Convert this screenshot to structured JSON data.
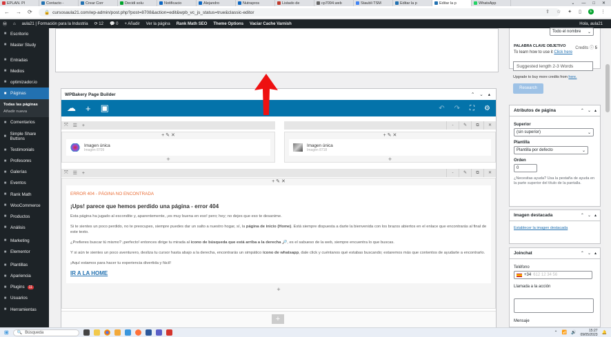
{
  "tabs": [
    {
      "label": "EPLAN. Pl",
      "color": "#d63638"
    },
    {
      "label": "Contacto -",
      "color": "#2271b1"
    },
    {
      "label": "Crear Corr",
      "color": "#2271b1"
    },
    {
      "label": "Decidi solu",
      "color": "#00a32a"
    },
    {
      "label": "Notificacio",
      "color": "#0a66c2"
    },
    {
      "label": "Alejandro",
      "color": "#0a66c2"
    },
    {
      "label": "Nutrapros",
      "color": "#0a66c2"
    },
    {
      "label": "Listado de",
      "color": "#c0392b"
    },
    {
      "label": "cp7094.web",
      "color": "#666"
    },
    {
      "label": "Staubli TSM",
      "color": "#4285f4"
    },
    {
      "label": "Editar la p",
      "color": "#2271b1"
    },
    {
      "label": "Editar la p",
      "color": "#2271b1"
    },
    {
      "label": "WhatsApp",
      "color": "#25d366"
    }
  ],
  "browser": {
    "url": "cursosaula21.com/wp-admin/post.php?post=8708&action=edit&wpb_vc_js_status=true&classic-editor",
    "tab_controls": [
      "⌄",
      "—",
      "□",
      "✕"
    ]
  },
  "adminbar": {
    "site": "aula21 | Formación para la Industria",
    "updates": "12",
    "comments": "0",
    "new": "+ Añadir",
    "view": "Ver la página",
    "seo": "Rank Math SEO",
    "theme": "Theme Options",
    "cache": "Vaciar Cache Varnish",
    "howdy": "Hola, aula21"
  },
  "sidebar": {
    "items": [
      {
        "label": "Escritorio",
        "icon": "dashboard-icon"
      },
      {
        "label": "Master Study",
        "icon": "m-icon"
      },
      {
        "label": "Entradas",
        "icon": "pin-icon"
      },
      {
        "label": "Medios",
        "icon": "media-icon"
      },
      {
        "label": "optimizador.io",
        "icon": "gear-icon"
      },
      {
        "label": "Páginas",
        "icon": "page-icon"
      }
    ],
    "sub": [
      "Todas las páginas",
      "Añadir nueva"
    ],
    "items2": [
      {
        "label": "Comentarios",
        "icon": "comment-icon"
      },
      {
        "label": "Simple Share Buttons",
        "icon": "share-icon"
      },
      {
        "label": "Testimonials",
        "icon": "quote-icon"
      },
      {
        "label": "Profesores",
        "icon": "user-icon"
      },
      {
        "label": "Galerías",
        "icon": "gallery-icon"
      },
      {
        "label": "Eventos",
        "icon": "calendar-icon"
      },
      {
        "label": "Rank Math",
        "icon": "chart-icon"
      },
      {
        "label": "WooCommerce",
        "icon": "woo-icon"
      },
      {
        "label": "Productos",
        "icon": "box-icon"
      },
      {
        "label": "Análisis",
        "icon": "bar-icon"
      },
      {
        "label": "Marketing",
        "icon": "megaphone-icon"
      },
      {
        "label": "Elementor",
        "icon": "e-icon"
      },
      {
        "label": "Plantillas",
        "icon": "folder-icon"
      },
      {
        "label": "Apariencia",
        "icon": "brush-icon"
      },
      {
        "label": "Plugins",
        "icon": "plug-icon",
        "badge": "11"
      },
      {
        "label": "Usuarios",
        "icon": "users-icon"
      },
      {
        "label": "Herramientas",
        "icon": "wrench-icon"
      }
    ]
  },
  "wpbakery": {
    "title": "WPBakery Page Builder",
    "el1": {
      "title": "Imagen única",
      "sub": "Imagen 8709"
    },
    "el2": {
      "title": "Imagen única",
      "sub": "Imagen 8718"
    },
    "error_heading": "ERROR 404 - PÁGINA NO ENCONTRADA",
    "h3": "¡Ups! parece que hemos perdido una página - error 404",
    "p1": "Esta página ha jugado al escondite y, aparentemente, ¡es muy buena en eso! pero; hey; no dejes que eso te desanime.",
    "p2a": "Si te sientes un poco perdido, no te preocupes, siempre puedes dar un salto a nuestro hogar, sí, la ",
    "p2b": "página de inicio (Home)",
    "p2c": ". Está siempre dispuesta a darte la bienvenida con los brazos abiertos en el enlace que encontrarás al final de este texto.",
    "p3a": "¿Prefieres buscar tú mismo? ¡perfecto! entonces dirige tu mirada al ",
    "p3b": "icono de búsqueda que está arriba a la derecha",
    "p3c": " 🔎, es el sabueso de la web, siempre encuentra lo que buscas.",
    "p4a": "Y si aún te sientes un poco aventurero, desliza tu cursor hasta abajo a la derecha, encontrarás un simpático ",
    "p4b": "icono de whatsapp",
    "p4c": ", dale click y cuéntanos qué estabas buscando; estaremos más que contentos de ayudarte a encontrarlo.",
    "p5": "¡Aquí estamos para hacer tu experiencia divertida y fácil!",
    "link": "IR A LA HOME"
  },
  "right": {
    "todo": "Todo el nombre",
    "kw_label": "PALABRA CLAVE OBJETIVO",
    "credits": "Credits",
    "credits_n": "5",
    "howto": "To learn how to use it ",
    "click": "Click here",
    "kw_placeholder": "Suggested length 2-3 Words",
    "upgrade": "Upgrade to buy more credits from ",
    "here": "here.",
    "research": "Research",
    "attr_title": "Atributos de página",
    "superior": "Superior",
    "superior_val": "(sin superior)",
    "plantilla": "Plantilla",
    "plantilla_val": "Plantilla por defecto",
    "orden": "Orden",
    "orden_val": "0",
    "help": "¿Necesitas ayuda? Usa la pestaña de ayuda en la parte superior del título de la pantalla.",
    "img_title": "Imagen destacada",
    "img_link": "Establecer la imagen destacada",
    "join_title": "Joinchat",
    "telefono": "Teléfono",
    "prefix": "+34",
    "phone_ph": "612 12 34 56",
    "llamada": "Llamada a la acción",
    "mensaje": "Mensaje"
  },
  "taskbar": {
    "search": "Búsqueda",
    "time": "15:27",
    "date": "09/05/2023"
  }
}
